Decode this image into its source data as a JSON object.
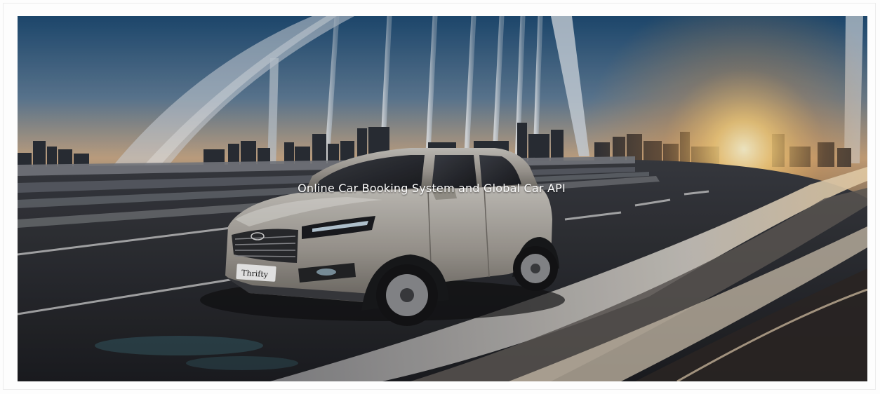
{
  "banner": {
    "headline": "Online Car Booking System and Global Car API",
    "plate_text": "Thrifty",
    "colors": {
      "sky_top": "#1f4c74",
      "sky_horizon": "#c9a987",
      "sun": "#ffe8a8",
      "road": "#2c2e33",
      "car_body": "#a7a39d",
      "headline": "#ffffff"
    }
  }
}
